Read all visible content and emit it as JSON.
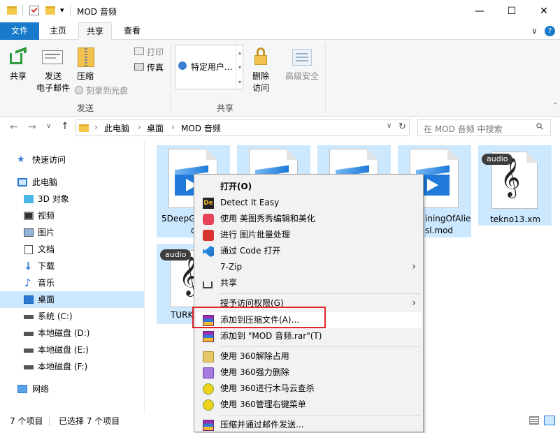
{
  "window": {
    "title": "MOD 音频",
    "qat_dropdown": "▾",
    "minimize": "—",
    "maximize": "☐",
    "close": "✕"
  },
  "tabs": {
    "file": "文件",
    "home": "主页",
    "share": "共享",
    "view": "查看",
    "help_toggle": "∨",
    "help": "?"
  },
  "ribbon": {
    "share": "共享",
    "email_1": "发送",
    "email_2": "电子邮件",
    "zip": "压缩",
    "burn": "刻录到光盘",
    "print": "打印",
    "fax": "传真",
    "send_group": "发送",
    "share_with_item": "特定用户...",
    "remove_access_1": "删除",
    "remove_access_2": "访问",
    "advanced_security": "高级安全",
    "share_group": "共享"
  },
  "nav": {
    "back": "←",
    "forward": "→",
    "recent": "∨",
    "up": "↑",
    "breadcrumb": [
      "此电脑",
      "桌面",
      "MOD 音频"
    ],
    "separator": "›",
    "address_dropdown": "∨",
    "refresh": "↻",
    "search_placeholder": "在 MOD 音频 中搜索",
    "search_icon": "⚲"
  },
  "sidebar": {
    "quick_access": "快速访问",
    "this_pc": "此电脑",
    "objects_3d": "3D 对象",
    "videos": "视频",
    "pictures": "图片",
    "documents": "文档",
    "downloads": "下载",
    "music": "音乐",
    "desktop": "桌面",
    "drive_c": "系统 (C:)",
    "drive_d": "本地磁盘 (D:)",
    "drive_e": "本地磁盘 (E:)",
    "drive_f": "本地磁盘 (F:)",
    "network": "网络"
  },
  "files": {
    "file1_line1": "5DeepG",
    "file1_line2": "d",
    "file4_line1": "iningOfAlie",
    "file4_line2": "sl.mod",
    "audio_badge": "audio",
    "file5_name": "tekno13.xm",
    "file6_name": "TURK"
  },
  "status": {
    "count": "7 个项目",
    "selected": "已选择 7 个项目"
  },
  "context_menu": {
    "open": "打开(O)",
    "detect": "Detect It Easy",
    "meitu": "使用 美图秀秀编辑和美化",
    "batch": "进行 图片批量处理",
    "vscode": "通过 Code 打开",
    "sevenzip": "7-Zip",
    "share": "共享",
    "grant": "授予访问权限(G)",
    "add_archive": "添加到压缩文件(A)...",
    "add_rar": "添加到 \"MOD 音频.rar\"(T)",
    "unlock_360": "使用 360解除占用",
    "delete_360": "使用 360强力删除",
    "scan_360": "使用 360进行木马云查杀",
    "menu_360": "使用 360管理右键菜单",
    "compress_email": "压缩并通过邮件发送...",
    "submenu_arrow": "›"
  },
  "colors": {
    "accent": "#1979ca",
    "selection": "#cce8ff",
    "highlight_box": "#e0252b"
  }
}
